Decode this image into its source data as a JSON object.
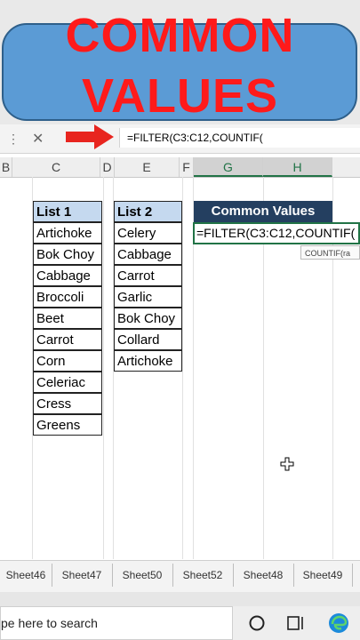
{
  "banner": {
    "line1": "COMMON",
    "line2": "VALUES"
  },
  "formula_bar": {
    "formula": "=FILTER(C3:C12,COUNTIF("
  },
  "columns": [
    "B",
    "C",
    "D",
    "E",
    "F",
    "G",
    "H"
  ],
  "list1": {
    "header": "List 1",
    "items": [
      "Artichoke",
      "Bok Choy",
      "Cabbage",
      "Broccoli",
      "Beet",
      "Carrot",
      "Corn",
      "Celeriac",
      "Cress",
      "Greens"
    ]
  },
  "list2": {
    "header": "List 2",
    "items": [
      "Celery",
      "Cabbage",
      "Carrot",
      "Garlic",
      "Bok Choy",
      "Collard",
      "Artichoke"
    ]
  },
  "common": {
    "header": "Common Values",
    "editing": "=FILTER(C3:C12,COUNTIF("
  },
  "tooltip": "COUNTIF(ra",
  "sheets": [
    "Sheet46",
    "Sheet47",
    "Sheet50",
    "Sheet52",
    "Sheet48",
    "Sheet49"
  ],
  "taskbar": {
    "search_placeholder": "pe here to search"
  },
  "colors": {
    "banner_fill": "#5b9bd5",
    "banner_text": "#ff1a1a",
    "excel_green": "#217346",
    "header_fill": "#c5d9ef",
    "dark_header": "#243f60"
  }
}
